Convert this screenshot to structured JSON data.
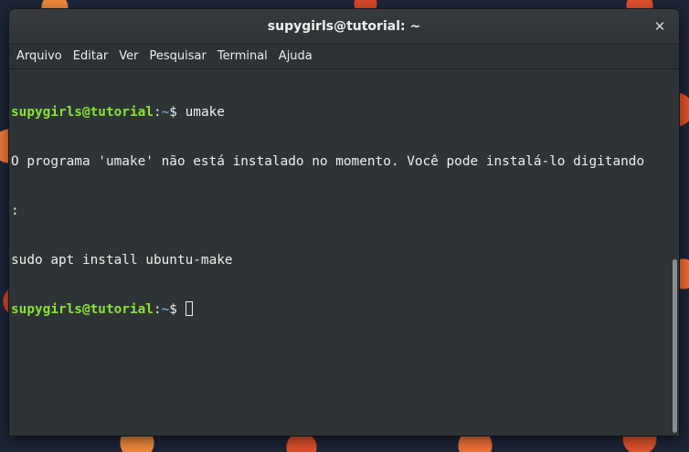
{
  "window": {
    "title": "supygirls@tutorial: ~",
    "close_glyph": "✕"
  },
  "menu": [
    "Arquivo",
    "Editar",
    "Ver",
    "Pesquisar",
    "Terminal",
    "Ajuda"
  ],
  "terminal": {
    "prompt_user": "supygirls@tutorial",
    "prompt_sep": ":",
    "prompt_path": "~",
    "prompt_symbol": "$ ",
    "command1": "umake",
    "output1": "O programa 'umake' não está instalado no momento. Você pode instalá-lo digitando",
    "output2": ":",
    "output3": "sudo apt install ubuntu-make"
  },
  "colors": {
    "prompt_user": "#8ae234",
    "prompt_path": "#729fcf",
    "background": "#2e3436"
  },
  "icons": {
    "close": "close-icon"
  }
}
